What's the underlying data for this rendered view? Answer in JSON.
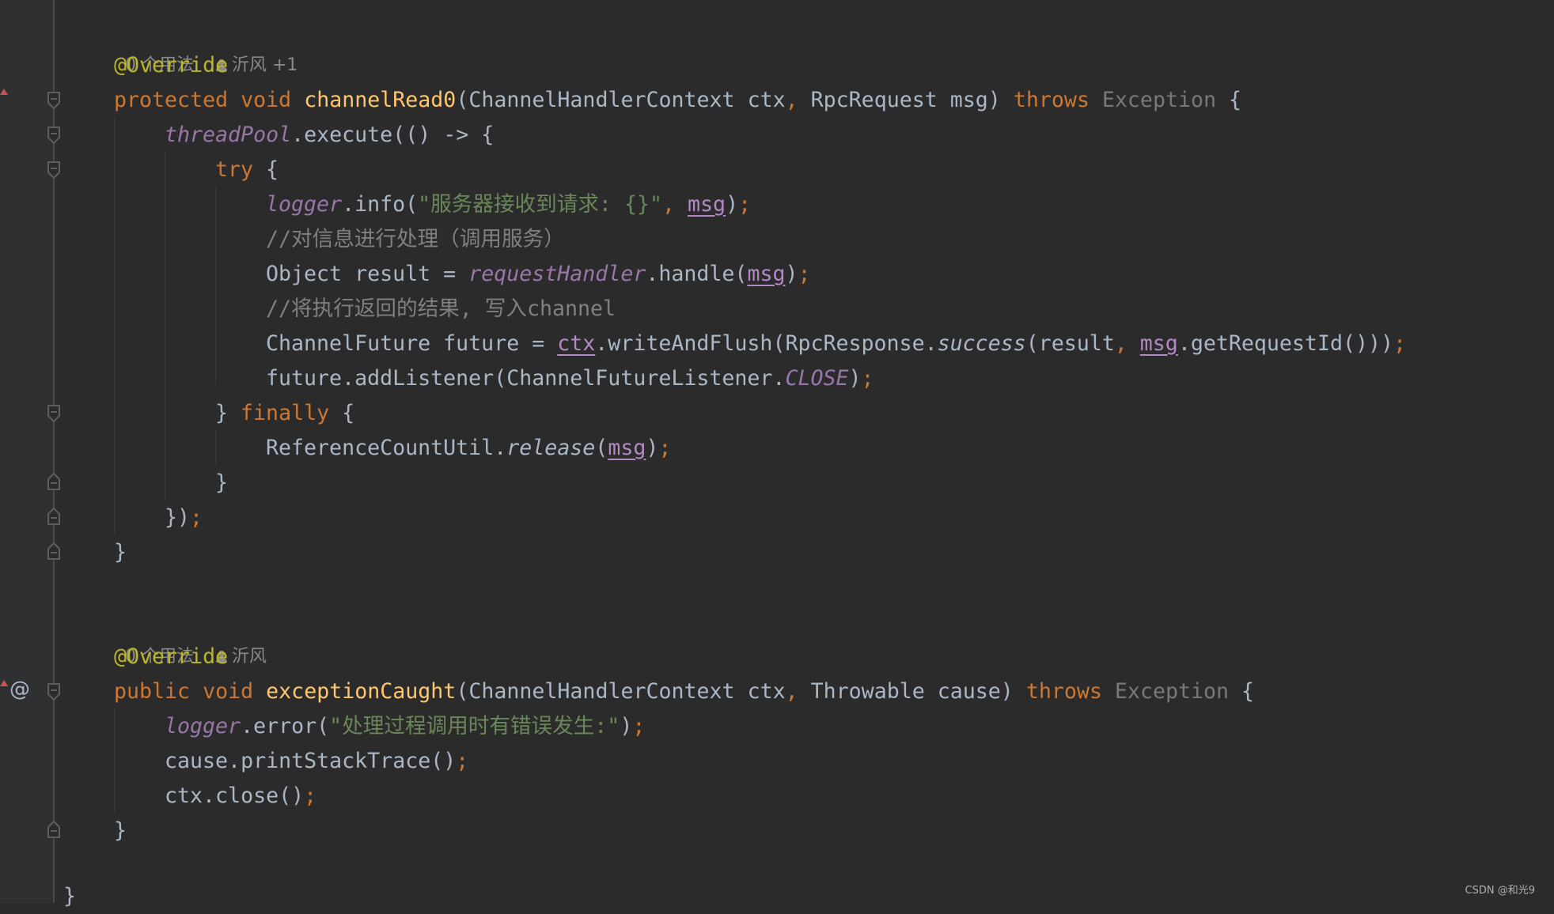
{
  "editor": {
    "theme_colors": {
      "background": "#2b2b2b",
      "keyword": "#cc7832",
      "annotation": "#bbb529",
      "method_decl": "#ffc66d",
      "field": "#9876aa",
      "string": "#6a8759",
      "comment": "#808080",
      "text": "#a9b7c6"
    },
    "method1": {
      "lens_usages": "0 个用法",
      "lens_author": "沂风 +1",
      "annotation": "@Override",
      "sig_modifier": "protected",
      "sig_void": "void",
      "sig_name": "channelRead0",
      "sig_params_a": "(ChannelHandlerContext ctx",
      "sig_params_b": " RpcRequest msg) ",
      "sig_throws": "throws",
      "sig_exception": " Exception",
      "sig_brace": " {",
      "l1_field": "threadPool",
      "l1_rest": ".execute(() -> {",
      "l2_try": "try",
      "l2_brace": " {",
      "l3_field": "logger",
      "l3_call": ".info(",
      "l3_str": "\"服务器接收到请求: {}\"",
      "l3_msg": "msg",
      "l3_end": ")",
      "l4_comment": "//对信息进行处理（调用服务）",
      "l5_pre": "Object result = ",
      "l5_field": "requestHandler",
      "l5_call": ".handle(",
      "l5_msg": "msg",
      "l5_end": ")",
      "l6_comment": "//将执行返回的结果, 写入channel",
      "l7_pre": "ChannelFuture future = ",
      "l7_ctx": "ctx",
      "l7_mid": ".writeAndFlush(RpcResponse.",
      "l7_success": "success",
      "l7_args": "(result",
      "l7_msg": "msg",
      "l7_end": ".getRequestId()))",
      "l8_pre": "future.addListener(ChannelFutureListener.",
      "l8_const": "CLOSE",
      "l8_end": ")",
      "l9_close": "} ",
      "l9_finally": "finally",
      "l9_brace": " {",
      "l10_pre": "ReferenceCountUtil.",
      "l10_release": "release",
      "l10_open": "(",
      "l10_msg": "msg",
      "l10_end": ")",
      "l11": "}",
      "l12": "})",
      "l13": "}"
    },
    "method2": {
      "lens_usages": "0 个用法",
      "lens_author": "沂风",
      "annotation": "@Override",
      "sig_modifier": "public",
      "sig_void": "void",
      "sig_name": "exceptionCaught",
      "sig_params_a": "(ChannelHandlerContext ctx",
      "sig_params_b": " Throwable cause) ",
      "sig_throws": "throws",
      "sig_exception": " Exception",
      "sig_brace": " {",
      "l1_field": "logger",
      "l1_call": ".error(",
      "l1_str": "\"处理过程调用时有错误发生:\"",
      "l1_end": ")",
      "l2": "cause.printStackTrace()",
      "l3": "ctx.close()",
      "l4": "}"
    },
    "class_close": "}",
    "semicolon": ";",
    "comma": ",",
    "gutter_at_icon": "@"
  },
  "watermark": "CSDN @和光9"
}
